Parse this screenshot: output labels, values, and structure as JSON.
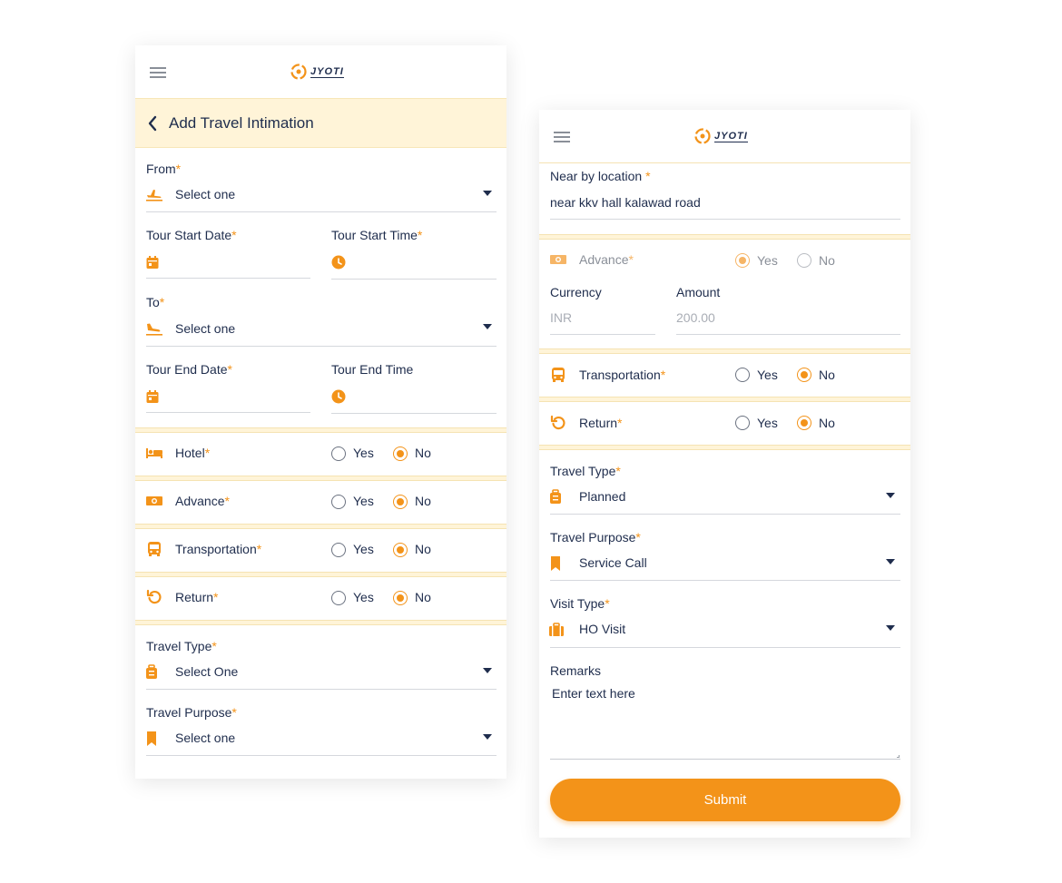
{
  "left": {
    "title": "Add Travel Intimation",
    "from": {
      "label": "From",
      "value": "Select one"
    },
    "tour_start_date": {
      "label": "Tour Start Date"
    },
    "tour_start_time": {
      "label": "Tour Start Time"
    },
    "to": {
      "label": "To",
      "value": "Select one"
    },
    "tour_end_date": {
      "label": "Tour End Date"
    },
    "tour_end_time": {
      "label": "Tour End Time"
    },
    "toggles": [
      {
        "label": "Hotel",
        "yes": "Yes",
        "no": "No",
        "selected": "No"
      },
      {
        "label": "Advance",
        "yes": "Yes",
        "no": "No",
        "selected": "No"
      },
      {
        "label": "Transportation",
        "yes": "Yes",
        "no": "No",
        "selected": "No"
      },
      {
        "label": "Return",
        "yes": "Yes",
        "no": "No",
        "selected": "No"
      }
    ],
    "travel_type": {
      "label": "Travel Type",
      "value": "Select One"
    },
    "travel_purpose": {
      "label": "Travel Purpose",
      "value": "Select one"
    }
  },
  "right": {
    "near_by_location": {
      "label": "Near by location",
      "value": "near kkv hall kalawad road"
    },
    "advance": {
      "label": "Advance",
      "yes": "Yes",
      "no": "No",
      "selected": "Yes"
    },
    "currency": {
      "label": "Currency",
      "value": "INR"
    },
    "amount": {
      "label": "Amount",
      "value": "200.00"
    },
    "transportation": {
      "label": "Transportation",
      "yes": "Yes",
      "no": "No",
      "selected": "No"
    },
    "return": {
      "label": "Return",
      "yes": "Yes",
      "no": "No",
      "selected": "No"
    },
    "travel_type": {
      "label": "Travel Type",
      "value": "Planned"
    },
    "travel_purpose": {
      "label": "Travel Purpose",
      "value": "Service Call"
    },
    "visit_type": {
      "label": "Visit Type",
      "value": "HO Visit"
    },
    "remarks": {
      "label": "Remarks",
      "placeholder": "Enter text here"
    },
    "submit_label": "Submit"
  },
  "brand": {
    "logo_text": "JYOTI",
    "accent": "#f39319",
    "navy": "#1f2d4d",
    "band": "#fff4d8"
  },
  "icons": [
    "menu-icon",
    "logo-icon",
    "back-icon",
    "plane-takeoff-icon",
    "calendar-icon",
    "clock-icon",
    "plane-landing-icon",
    "bed-icon",
    "cash-icon",
    "bus-icon",
    "undo-icon",
    "luggage-icon",
    "bookmark-icon",
    "briefcase-icon"
  ]
}
